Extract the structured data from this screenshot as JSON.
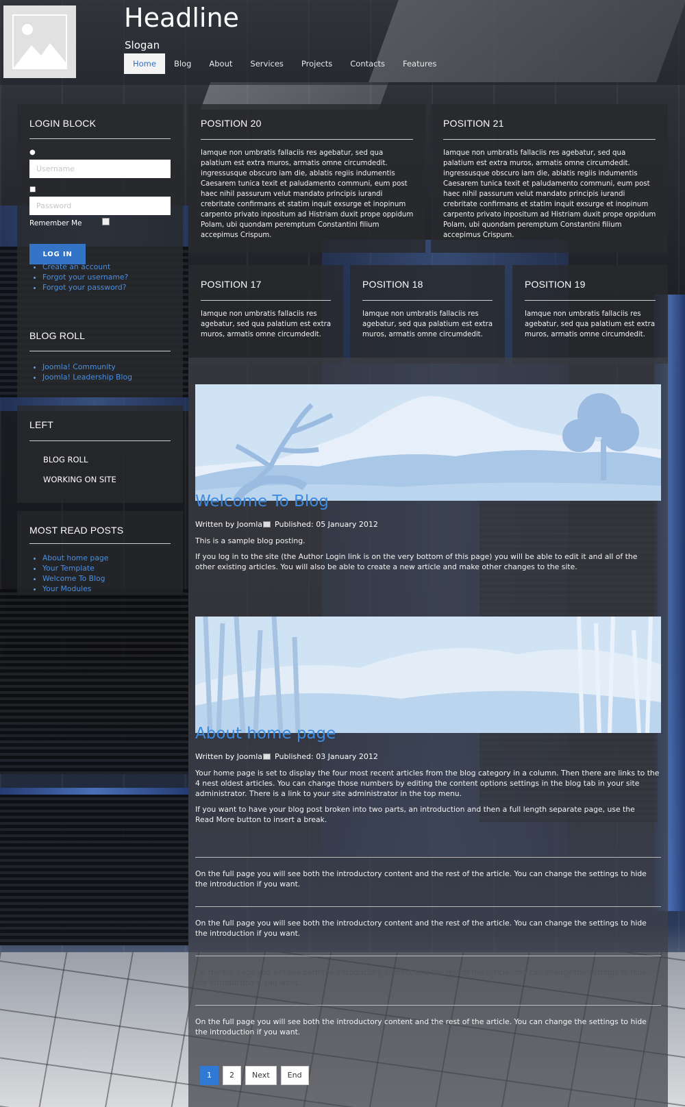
{
  "header": {
    "title": "Headline",
    "slogan": "Slogan",
    "nav": [
      "Home",
      "Blog",
      "About",
      "Services",
      "Projects",
      "Contacts",
      "Features"
    ]
  },
  "login": {
    "title": "LOGIN BLOCK",
    "username_placeholder": "Username",
    "password_placeholder": "Password",
    "remember_label": "Remember Me",
    "button": "LOG IN",
    "links": [
      "Create an account",
      "Forgot your username?",
      "Forgot your password?"
    ]
  },
  "blogroll": {
    "title": "BLOG ROLL",
    "links": [
      "Joomla! Community",
      "Joomla! Leadership Blog"
    ]
  },
  "left_menu": {
    "title": "LEFT",
    "items": [
      "BLOG ROLL",
      "WORKING ON SITE"
    ]
  },
  "most_read": {
    "title": "MOST READ POSTS",
    "links": [
      "About home page",
      "Your Template",
      "Welcome To Blog",
      "Your Modules"
    ]
  },
  "positions": {
    "p20": {
      "title": "POSITION 20",
      "text": "Iamque non umbratis fallaciis res agebatur, sed qua palatium est extra muros, armatis omne circumdedit. ingressusque obscuro iam die, ablatis regiis indumentis Caesarem tunica texit et paludamento communi, eum post haec nihil passurum velut mandato principis iurandi crebritate confirmans et statim inquit exsurge et inopinum carpento privato inpositum ad Histriam duxit prope oppidum Polam, ubi quondam peremptum Constantini filium accepimus Crispum."
    },
    "p21": {
      "title": "POSITION 21",
      "text": "Iamque non umbratis fallaciis res agebatur, sed qua palatium est extra muros, armatis omne circumdedit. ingressusque obscuro iam die, ablatis regiis indumentis Caesarem tunica texit et paludamento communi, eum post haec nihil passurum velut mandato principis iurandi crebritate confirmans et statim inquit exsurge et inopinum carpento privato inpositum ad Histriam duxit prope oppidum Polam, ubi quondam peremptum Constantini filium accepimus Crispum."
    },
    "p17": {
      "title": "POSITION 17",
      "text": "Iamque non umbratis fallaciis res agebatur, sed qua palatium est extra muros, armatis omne circumdedit."
    },
    "p18": {
      "title": "POSITION 18",
      "text": "Iamque non umbratis fallaciis res agebatur, sed qua palatium est extra muros, armatis omne circumdedit."
    },
    "p19": {
      "title": "POSITION 19",
      "text": "Iamque non umbratis fallaciis res agebatur, sed qua palatium est extra muros, armatis omne circumdedit."
    }
  },
  "articles": [
    {
      "title": "Welcome To Blog",
      "written_by": "Written by Joomla",
      "published": "Published: 05 January 2012",
      "paragraphs": [
        "This is a sample blog posting.",
        "If you log in to the site (the Author Login link is on the very bottom of this page) you will be able to edit it and all of the other existing articles. You will also be able to create a new article and make other changes to the site."
      ]
    },
    {
      "title": "About home page",
      "written_by": "Written by Joomla",
      "published": "Published: 03 January 2012",
      "paragraphs": [
        "Your home page is set to display the four most recent articles from the blog category in a column. Then there are links to the 4 nest oldest articles. You can change those numbers by editing the content options settings in the blog tab in your site administrator. There is a link to your site administrator in the top menu.",
        "If you want to have your blog post broken into two parts, an introduction and then a full length separate page, use the Read More button to insert a break.",
        "On the full page you will see both the introductory content and the rest of the article. You can change the settings to hide the introduction if you want.",
        "On the full page you will see both the introductory content and the rest of the article. You can change the settings to hide the introduction if you want.",
        "On the full page you will see both the introductory content and the rest of the article. You can change the settings to hide the introduction if you want.",
        "On the full page you will see both the introductory content and the rest of the article. You can change the settings to hide the introduction if you want."
      ]
    }
  ],
  "pagination": [
    "1",
    "2",
    "Next",
    "End"
  ],
  "colors": {
    "accent": "#3d8be0",
    "button": "#3474c6",
    "link": "#4a90e2"
  }
}
